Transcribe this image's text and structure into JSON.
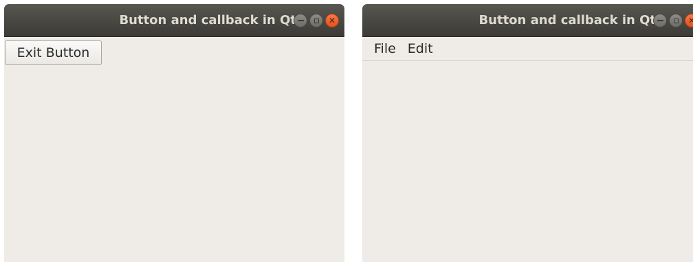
{
  "windows": [
    {
      "title": "Button and callback in Qt",
      "exit_button_label": "Exit Button"
    },
    {
      "title": "Button and callback in Qt",
      "menu": [
        "File",
        "Edit"
      ]
    }
  ],
  "colors": {
    "titlebar": "#3c3b37",
    "title_text": "#dfdbd2",
    "window_bg": "#efebe7",
    "close_button": "#e95420"
  },
  "icons": {
    "minimize": "minimize-icon",
    "maximize": "maximize-icon",
    "close": "close-icon"
  }
}
